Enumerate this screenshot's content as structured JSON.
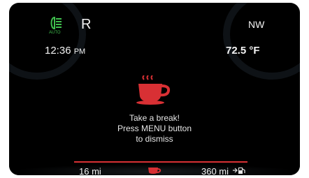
{
  "status_bar": {
    "auto_label": "AUTO",
    "gear": "R",
    "compass": "NW"
  },
  "info_row": {
    "time": "12:36",
    "time_period": "PM",
    "temperature": "72.5 °F"
  },
  "alert": {
    "icon": "coffee-cup-icon",
    "lines": [
      "Take a break!",
      "Press MENU button",
      "to dismiss"
    ]
  },
  "bottom_bar": {
    "left_distance": "16 mi",
    "range": "360 mi"
  },
  "colors": {
    "accent_red": "#d83034",
    "auto_green": "#3fbf4d",
    "background": "#000000"
  }
}
